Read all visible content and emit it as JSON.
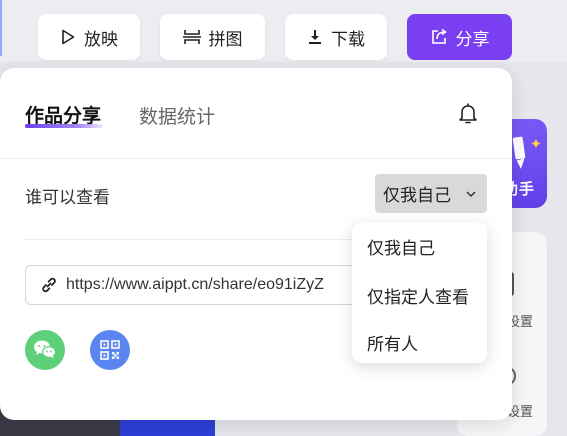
{
  "toolbar": {
    "play_label": "放映",
    "collage_label": "拼图",
    "download_label": "下载",
    "share_label": "分享"
  },
  "share_panel": {
    "tabs": [
      {
        "label": "作品分享",
        "active": true
      },
      {
        "label": "数据统计",
        "active": false
      }
    ],
    "who_can_view_label": "谁可以查看",
    "visibility_select_value": "仅我自己",
    "link_url": "https://www.aippt.cn/share/eo91iZyZ",
    "icons": [
      "bell-icon",
      "link-icon",
      "wechat-icon",
      "qrcode-icon"
    ]
  },
  "dropdown": {
    "options": [
      "仅我自己",
      "仅指定人查看",
      "所有人"
    ]
  },
  "background_app": {
    "assistant_label": "助手",
    "right_panel_items": [
      "设置",
      "设置"
    ]
  },
  "colors": {
    "accent": "#7a3ff2",
    "wechat": "#5fd07a",
    "qrcode": "#5b85f0"
  }
}
